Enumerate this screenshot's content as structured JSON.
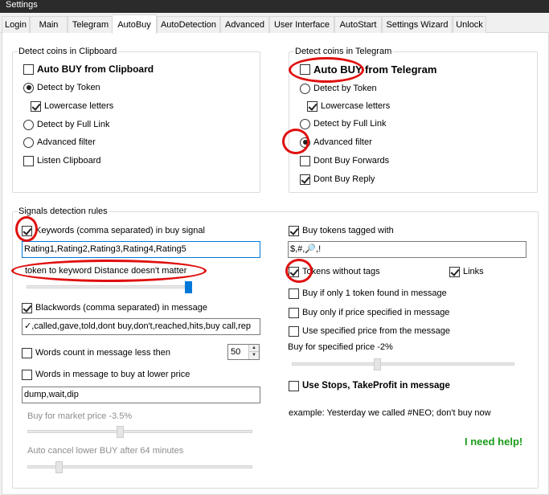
{
  "window": {
    "title": "Settings"
  },
  "tabs": [
    {
      "label": "Login"
    },
    {
      "label": "Main"
    },
    {
      "label": "Telegram"
    },
    {
      "label": "AutoBuy"
    },
    {
      "label": "AutoDetection"
    },
    {
      "label": "Advanced"
    },
    {
      "label": "User Interface"
    },
    {
      "label": "AutoStart"
    },
    {
      "label": "Settings Wizard"
    },
    {
      "label": "Unlock"
    }
  ],
  "active_tab": "AutoBuy",
  "clipboard": {
    "title": "Detect coins in Clipboard",
    "auto_buy": "Auto BUY from Clipboard",
    "by_token": "Detect by Token",
    "lowercase": "Lowercase letters",
    "full_link": "Detect by Full Link",
    "advanced": "Advanced filter",
    "listen": "Listen Clipboard"
  },
  "telegram": {
    "title": "Detect coins in Telegram",
    "auto_buy": "Auto BUY from Telegram",
    "by_token": "Detect by Token",
    "lowercase": "Lowercase letters",
    "full_link": "Detect by Full Link",
    "advanced": "Advanced filter",
    "forwards": "Dont Buy Forwards",
    "reply": "Dont Buy Reply"
  },
  "signals": {
    "title": "Signals detection rules",
    "keywords_label": "Keywords (comma separated) in buy signal",
    "keywords_value": "Rating1,Rating2,Rating3,Rating4,Rating5",
    "distance_label": "token to keyword Distance doesn't matter",
    "blackwords_label": "Blackwords (comma separated) in message",
    "blackwords_value": "✓,called,gave,told,dont buy,don't,reached,hits,buy call,rep",
    "words_count_label": "Words count in message less then",
    "words_count_value": "50",
    "lower_price_label": "Words in message to buy at lower price",
    "lower_price_value": "dump,wait,dip",
    "market_price_label": "Buy for market price -3.5%",
    "auto_cancel_label": "Auto cancel lower BUY after 64 minutes",
    "tagged_label": "Buy tokens tagged with",
    "tagged_value": "$,#,🔎,!",
    "without_tags": "Tokens without tags",
    "links": "Links",
    "only_one": "Buy if only 1 token found in message",
    "only_price": "Buy only if price specified in message",
    "use_specified": "Use specified price from the message",
    "specified_label": "Buy for specified price -2%",
    "stops": "Use Stops, TakeProfit in message",
    "example": "example: Yesterday we called #NEO; don't buy now",
    "help": "I need help!"
  },
  "sliders": {
    "distance": 1.0,
    "market_price": 0.41,
    "auto_cancel": 0.13,
    "specified_price": 0.38
  },
  "colors": {
    "annotation": "#e01010",
    "help": "#1a9c1a",
    "focus": "#0078d7"
  }
}
